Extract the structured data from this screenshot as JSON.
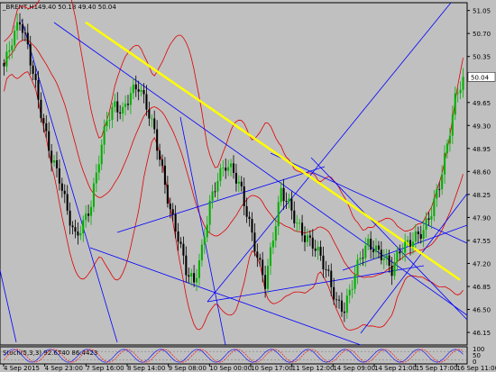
{
  "window": {
    "symbol_line": "_BRENT,H1",
    "ohlc_line": "49.40 50.18 49.40 50.04"
  },
  "oscillator": {
    "label": "Stoch(5,3,3) 92.6740 86.4423"
  },
  "colors": {
    "background": "#c0c0c0",
    "bull": "#00b000",
    "bear": "#000000",
    "bands": "#e00000",
    "trendlines": "#0000ff",
    "highlight_line": "#ffff00",
    "price_tag": "#ffffff"
  },
  "chart_data": {
    "type": "candlestick",
    "ylim": [
      46.0,
      51.1
    ],
    "y_ticks": [
      "51.05",
      "50.70",
      "50.35",
      "50.04",
      "49.65",
      "49.30",
      "48.95",
      "48.60",
      "48.25",
      "47.90",
      "47.55",
      "47.20",
      "46.85",
      "46.50",
      "46.15"
    ],
    "current_price": "50.04",
    "x_ticks": [
      "4 Sep 2015",
      "4 Sep 23:00",
      "7 Sep 16:00",
      "8 Sep 14:00",
      "9 Sep 08:00",
      "10 Sep 00:00",
      "10 Sep 17:00",
      "11 Sep 12:00",
      "14 Sep 09:00",
      "14 Sep 21:00",
      "15 Sep 17:00",
      "16 Sep 11:00"
    ],
    "close_path": [
      50.2,
      50.6,
      50.9,
      50.5,
      49.9,
      49.3,
      48.8,
      48.5,
      48.0,
      47.6,
      47.8,
      48.1,
      48.8,
      49.4,
      49.6,
      49.5,
      49.8,
      49.9,
      49.6,
      49.2,
      48.6,
      48.0,
      47.6,
      47.1,
      46.9,
      47.4,
      48.1,
      48.5,
      48.7,
      48.6,
      48.3,
      47.8,
      47.3,
      46.9,
      47.6,
      48.3,
      48.1,
      47.8,
      47.6,
      47.5,
      47.3,
      47.0,
      46.6,
      46.5,
      46.9,
      47.3,
      47.5,
      47.4,
      47.3,
      47.1,
      47.4,
      47.5,
      47.6,
      47.7,
      48.0,
      48.4,
      49.0,
      49.7,
      50.04
    ],
    "yellow_line": {
      "x": [
        "4 Sep 23:00",
        "16 Sep 11:00"
      ],
      "y": [
        50.87,
        46.95
      ]
    },
    "oscillator_range": [
      0,
      100
    ],
    "oscillator_ticks": [
      "100",
      "50",
      "0"
    ]
  }
}
